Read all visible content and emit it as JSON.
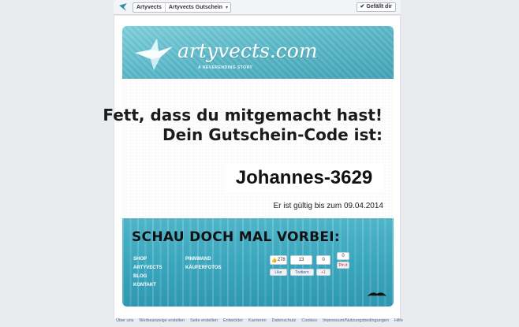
{
  "header": {
    "breadcrumbs": [
      "Artyvects",
      "Artyvects Gutschein"
    ],
    "like_label": "✔ Gefällt dir"
  },
  "banner": {
    "brand_name": "artyvects.com",
    "tagline": "A NEVERENDING STORY"
  },
  "message": {
    "line1": "Fett, dass du mitgemacht hast!",
    "line2": "Dein Gutschein-Code ist:",
    "code": "Johannes-3629",
    "validity": "Er ist gültig bis zum 09.04.2014"
  },
  "promo": {
    "title": "SCHAU DOCH MAL VORBEI:",
    "links_left": [
      "SHOP",
      "ARTYVECTS",
      "BLOG",
      "KONTAKT"
    ],
    "links_right": [
      "PINNWAND",
      "KÄUFERFOTOS"
    ],
    "social": {
      "fb_count": "278",
      "twitter_count": "13",
      "gplus_count": "0",
      "pin_count": "0",
      "like_label": "Like",
      "tweet_label": "Twittern",
      "gplus_label": "+1",
      "pin_label": "Pin it"
    }
  },
  "footer": {
    "links": [
      "Über uns",
      "Werbeanzeige erstellen",
      "Seite erstellen",
      "Entwickler",
      "Karrieren",
      "Datenschutz",
      "Cookies",
      "Impressum/Nutzungsbedingungen",
      "Hilfe"
    ]
  },
  "colors": {
    "banner": "#5ab8c8",
    "promo": "#3aa6bd",
    "fb_link": "#4b67a1"
  }
}
